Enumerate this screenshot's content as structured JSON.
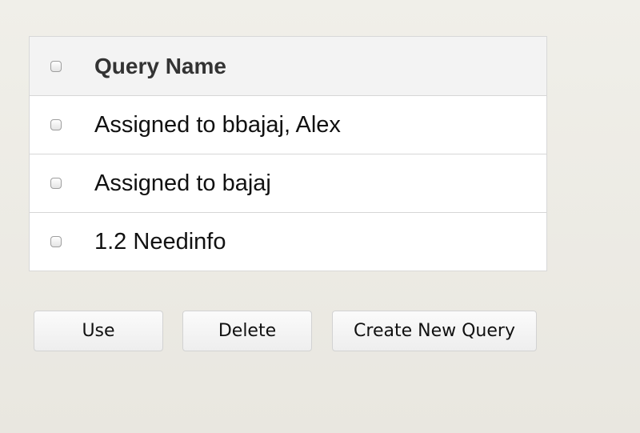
{
  "table": {
    "header": {
      "label": "Query Name"
    },
    "rows": [
      {
        "label": "Assigned to bbajaj, Alex"
      },
      {
        "label": "Assigned to bajaj"
      },
      {
        "label": "1.2 Needinfo"
      }
    ]
  },
  "buttons": {
    "use_label": "Use",
    "delete_label": "Delete",
    "create_label": "Create New Query"
  }
}
